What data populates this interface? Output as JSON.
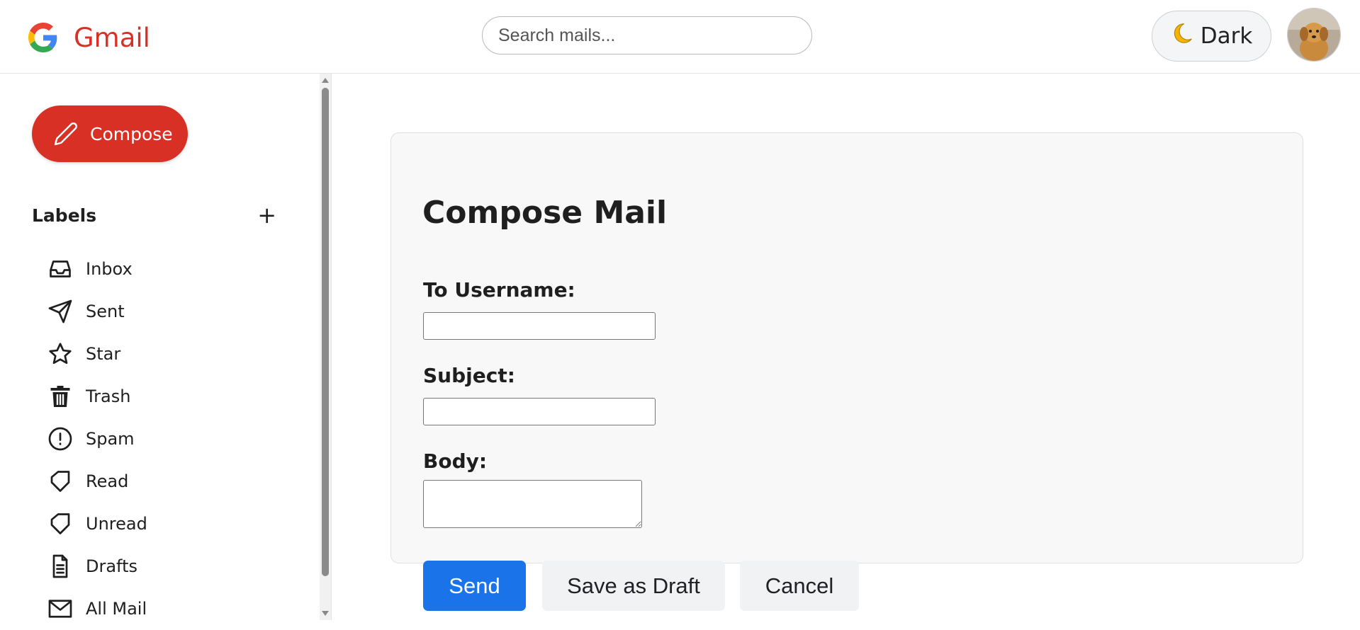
{
  "header": {
    "brand_name": "Gmail",
    "search_placeholder": "Search mails...",
    "theme_label": "Dark",
    "theme_icon": "moon-icon"
  },
  "sidebar": {
    "compose_label": "Compose",
    "labels_title": "Labels",
    "labels_add": "+",
    "items": [
      {
        "label": "Inbox",
        "icon": "inbox-icon"
      },
      {
        "label": "Sent",
        "icon": "send-icon"
      },
      {
        "label": "Star",
        "icon": "star-icon"
      },
      {
        "label": "Trash",
        "icon": "trash-icon"
      },
      {
        "label": "Spam",
        "icon": "alert-circle-icon"
      },
      {
        "label": "Read",
        "icon": "tag-icon"
      },
      {
        "label": "Unread",
        "icon": "tag-icon"
      },
      {
        "label": "Drafts",
        "icon": "file-text-icon"
      },
      {
        "label": "All Mail",
        "icon": "mail-icon"
      }
    ]
  },
  "compose_form": {
    "title": "Compose Mail",
    "to_label": "To Username:",
    "to_value": "",
    "subject_label": "Subject:",
    "subject_value": "",
    "body_label": "Body:",
    "body_value": "",
    "send_label": "Send",
    "draft_label": "Save as Draft",
    "cancel_label": "Cancel"
  },
  "colors": {
    "brand": "#d93025",
    "compose_button": "#d93025",
    "send_button": "#1a73e8",
    "secondary_button": "#f1f2f4",
    "card_background": "#f8f8f8"
  }
}
